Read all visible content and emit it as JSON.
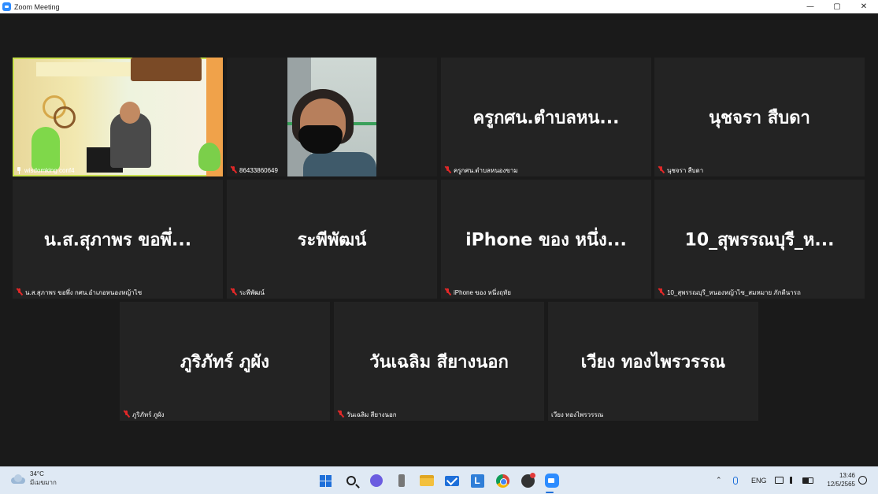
{
  "window": {
    "title": "Zoom Meeting",
    "minimize": "—",
    "maximize": "▢",
    "close": "✕"
  },
  "participants": [
    {
      "caption": "wisdomking conf4",
      "big_name": "",
      "video": true,
      "muted": false,
      "pinned": true,
      "active_speaker": true
    },
    {
      "caption": "86433860649",
      "big_name": "",
      "video": true,
      "muted": true
    },
    {
      "caption": "ครูกศน.ตำบลหนองขาม",
      "big_name": "ครูกศน.ตำบลหน...",
      "video": false,
      "muted": true
    },
    {
      "caption": "นุชจรา สืบดา",
      "big_name": "นุชจรา สืบดา",
      "video": false,
      "muted": true
    },
    {
      "caption": "น.ส.สุภาพร ขอพึ่ง กศน.อำเภอหนองหญ้าไซ",
      "big_name": "น.ส.สุภาพร ขอพึ่...",
      "video": false,
      "muted": true
    },
    {
      "caption": "ระพีพัฒน์",
      "big_name": "ระพีพัฒน์",
      "video": false,
      "muted": true
    },
    {
      "caption": "iPhone ของ หนึ่งฤทัย",
      "big_name": "iPhone ของ หนึ่ง...",
      "video": false,
      "muted": true
    },
    {
      "caption": "10_สุพรรณบุรี_หนองหญ้าไซ_สมหมาย ภักดีนารถ",
      "big_name": "10_สุพรรณบุรี_ห...",
      "video": false,
      "muted": true
    },
    {
      "caption": "ภูริภัทร์ ภูผัง",
      "big_name": "ภูริภัทร์ ภูผัง",
      "video": false,
      "muted": true
    },
    {
      "caption": "วันเฉลิม สียางนอก",
      "big_name": "วันเฉลิม สียางนอก",
      "video": false,
      "muted": true
    },
    {
      "caption": "เวียง ทองไพรวรรณ",
      "big_name": "เวียง ทองไพรวรรณ",
      "video": false,
      "muted": false
    }
  ],
  "taskbar": {
    "weather": {
      "temp": "34°C",
      "condition": "มีเมฆมาก"
    },
    "apps": [
      "windows-start",
      "search",
      "teams-chat",
      "usb-device",
      "file-explorer",
      "mail",
      "l-app",
      "chrome",
      "obs",
      "zoom"
    ],
    "tray": {
      "language": "ENG",
      "time": "13:46",
      "date": "12/5/2565"
    }
  }
}
